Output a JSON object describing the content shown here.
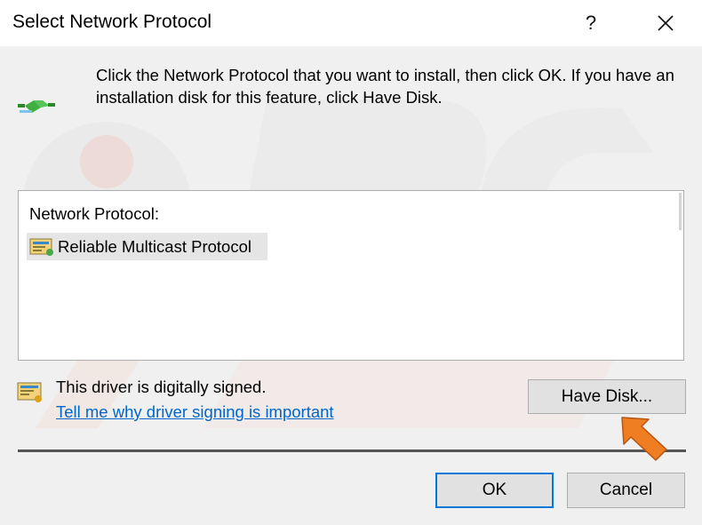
{
  "window": {
    "title": "Select Network Protocol",
    "help_label": "?",
    "close_icon": "close-icon"
  },
  "instruction": "Click the Network Protocol that you want to install, then click OK. If you have an installation disk for this feature, click Have Disk.",
  "protocol_list": {
    "header": "Network Protocol:",
    "items": [
      {
        "label": "Reliable Multicast Protocol",
        "icon": "protocol-icon",
        "selected": true
      }
    ]
  },
  "driver": {
    "signed_text": "This driver is digitally signed.",
    "link_text": "Tell me why driver signing is important"
  },
  "buttons": {
    "have_disk": "Have Disk...",
    "ok": "OK",
    "cancel": "Cancel"
  },
  "colors": {
    "accent": "#0078d7",
    "link": "#0066cc",
    "arrow": "#ef7d22"
  }
}
